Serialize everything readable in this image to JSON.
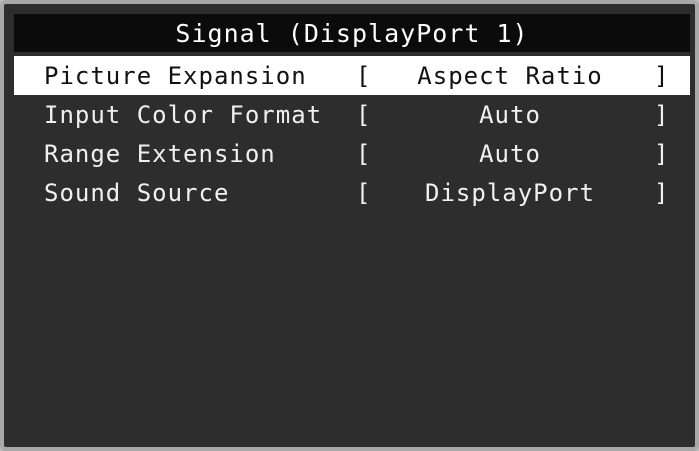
{
  "osd": {
    "title": "Signal (DisplayPort 1)",
    "items": [
      {
        "label": "Picture Expansion",
        "value": "Aspect Ratio",
        "selected": true
      },
      {
        "label": "Input Color Format",
        "value": "Auto",
        "selected": false
      },
      {
        "label": "Range Extension",
        "value": "Auto",
        "selected": false
      },
      {
        "label": "Sound Source",
        "value": "DisplayPort",
        "selected": false
      }
    ],
    "bracket_open": "[",
    "bracket_close": "]"
  },
  "colors": {
    "background": "#2d2d2d",
    "header_bg": "#0b0b0b",
    "selected_bg": "#ffffff",
    "text": "#f0f0f0",
    "selected_text": "#111111",
    "frame": "#a8a8a8"
  }
}
